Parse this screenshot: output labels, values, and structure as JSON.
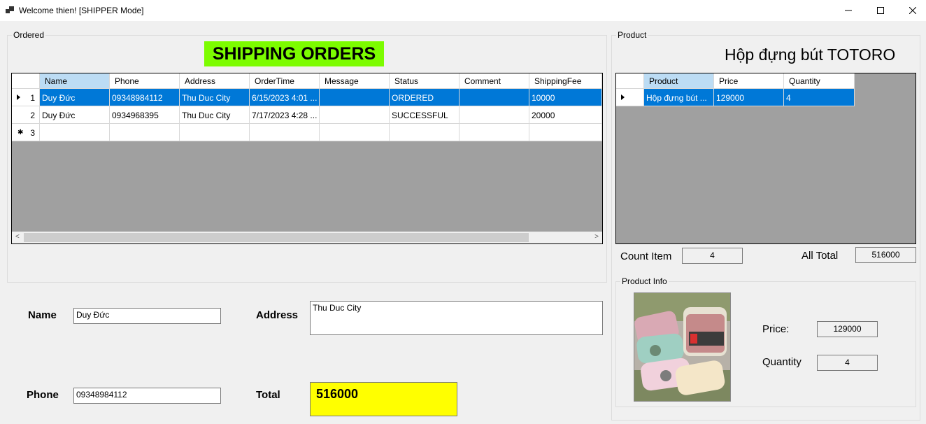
{
  "window": {
    "title": "Welcome thien! [SHIPPER Mode]"
  },
  "ordered": {
    "group_label": "Ordered",
    "heading": "SHIPPING ORDERS",
    "columns": [
      "Name",
      "Phone",
      "Address",
      "OrderTime",
      "Message",
      "Status",
      "Comment",
      "ShippingFee"
    ],
    "rows": [
      {
        "num": "1",
        "cells": [
          "Duy Đức",
          "09348984112",
          "Thu Duc City",
          "6/15/2023 4:01 ...",
          "",
          "ORDERED",
          "",
          "10000"
        ]
      },
      {
        "num": "2",
        "cells": [
          "Duy Đức",
          "0934968395",
          "Thu Duc City",
          "7/17/2023 4:28 ...",
          "",
          "SUCCESSFUL",
          "",
          "20000"
        ]
      }
    ],
    "new_row_num": "3"
  },
  "product": {
    "group_label": "Product",
    "title": "Hộp đựng bút TOTORO",
    "columns": [
      "Product",
      "Price",
      "Quantity"
    ],
    "rows": [
      {
        "cells": [
          "Hộp đựng bút ...",
          "129000",
          "4"
        ]
      }
    ],
    "count_item_label": "Count Item",
    "count_item_value": "4",
    "all_total_label": "All Total",
    "all_total_value": "516000"
  },
  "product_info": {
    "group_label": "Product Info",
    "price_label": "Price:",
    "price_value": "129000",
    "quantity_label": "Quantity",
    "quantity_value": "4"
  },
  "details": {
    "name_label": "Name",
    "name_value": "Duy Đức",
    "address_label": "Address",
    "address_value": "Thu Duc City",
    "phone_label": "Phone",
    "phone_value": "09348984112",
    "total_label": "Total",
    "total_value": "516000"
  },
  "colors": {
    "heading_bg": "#7cfc00",
    "total_bg": "#ffff00",
    "selection": "#0078d7",
    "header_selected": "#bcdcf4"
  }
}
